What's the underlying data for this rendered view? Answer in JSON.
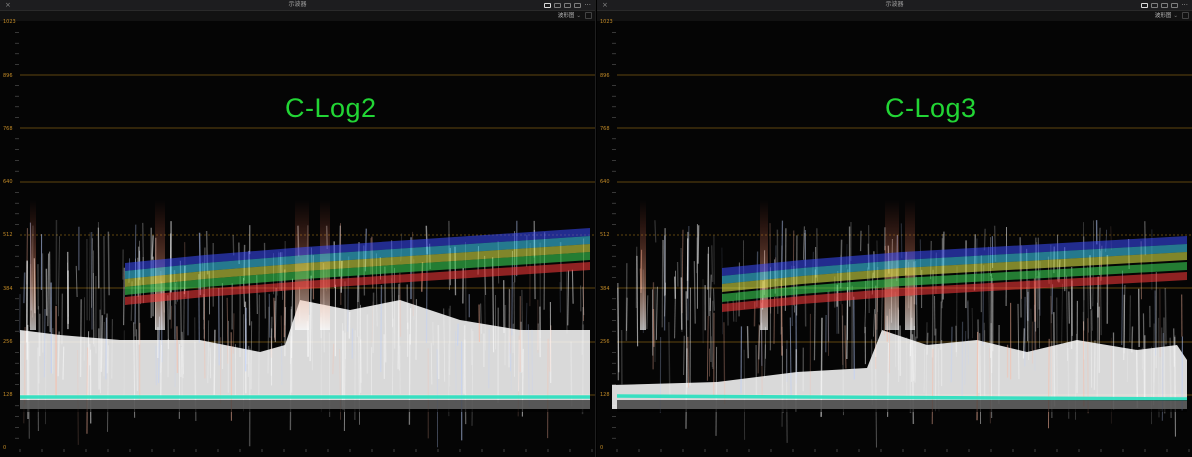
{
  "panels": [
    {
      "title": "示波器",
      "mode": "波形图",
      "overlay_label": "C-Log2",
      "scale_labels": [
        "1023",
        "896",
        "768",
        "640",
        "512",
        "384",
        "256",
        "128",
        "0"
      ]
    },
    {
      "title": "示波器",
      "mode": "波形图",
      "overlay_label": "C-Log3",
      "scale_labels": [
        "1023",
        "896",
        "768",
        "640",
        "512",
        "384",
        "256",
        "128",
        "0"
      ]
    }
  ],
  "colors": {
    "grid": "#8a6413",
    "label": "#c28a26",
    "overlay": "#22d635",
    "line": "#2fe0c0"
  },
  "icons": [
    "close-icon",
    "single-view-icon",
    "dual-view-icon",
    "quad-view-icon",
    "grid-view-icon",
    "more-options-icon",
    "settings-icon"
  ]
}
